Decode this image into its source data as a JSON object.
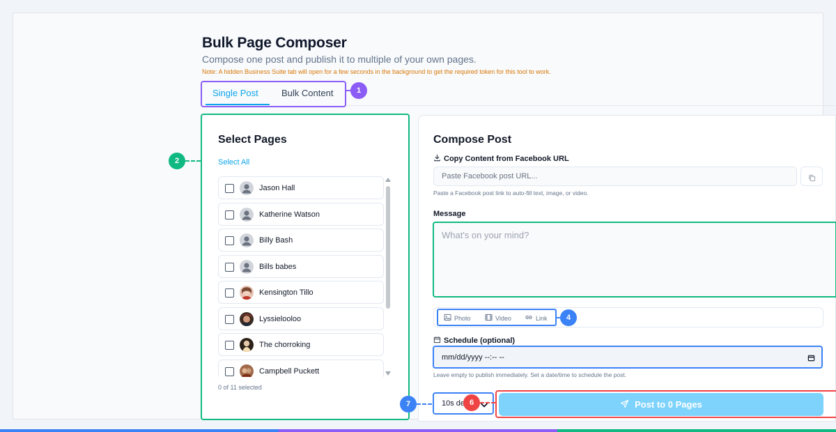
{
  "header": {
    "title": "Bulk Page Composer",
    "subtitle": "Compose one post and publish it to multiple of your own pages.",
    "note": "Note: A hidden Business Suite tab will open for a few seconds in the background to get the required token for this tool to work."
  },
  "tabs": [
    {
      "label": "Single Post",
      "active": true
    },
    {
      "label": "Bulk Content",
      "active": false
    }
  ],
  "markers": {
    "tabs": "1",
    "pages": "2",
    "attachments": "4",
    "post": "6",
    "delay": "7"
  },
  "select_pages": {
    "title": "Select Pages",
    "select_all": "Select All",
    "pages": [
      {
        "name": "Jason Hall",
        "avatar": "person-icon"
      },
      {
        "name": "Katherine Watson",
        "avatar": "person-icon"
      },
      {
        "name": "Billy Bash",
        "avatar": "person-icon"
      },
      {
        "name": "Bills babes",
        "avatar": "person-icon"
      },
      {
        "name": "Kensington Tillo",
        "avatar": "photo"
      },
      {
        "name": "Lyssielooloo",
        "avatar": "photo"
      },
      {
        "name": "The chorroking",
        "avatar": "photo"
      },
      {
        "name": "Campbell Puckett",
        "avatar": "photo"
      }
    ],
    "selected_count": "0 of 11 selected"
  },
  "compose": {
    "title": "Compose Post",
    "copy_label": "Copy Content from Facebook URL",
    "url_placeholder": "Paste Facebook post URL...",
    "url_hint": "Paste a Facebook post link to auto-fill text, image, or video.",
    "message_label": "Message",
    "message_placeholder": "What's on your mind?",
    "attachments": [
      "Photo",
      "Video",
      "Link"
    ],
    "schedule_label": "Schedule (optional)",
    "schedule_value": "mm/dd/yyyy --:-- --",
    "schedule_hint": "Leave empty to publish immediately. Set a date/time to schedule the post.",
    "delay_value": "10s de",
    "post_button": "Post to 0 Pages"
  },
  "colors": {
    "accent": "#0ea5e9",
    "marker_purple": "#8b5cf6",
    "marker_green": "#10b981",
    "marker_blue": "#3b82f6",
    "marker_red": "#ef4444",
    "post_button_bg": "#7dd3fc",
    "note": "#d97706"
  }
}
